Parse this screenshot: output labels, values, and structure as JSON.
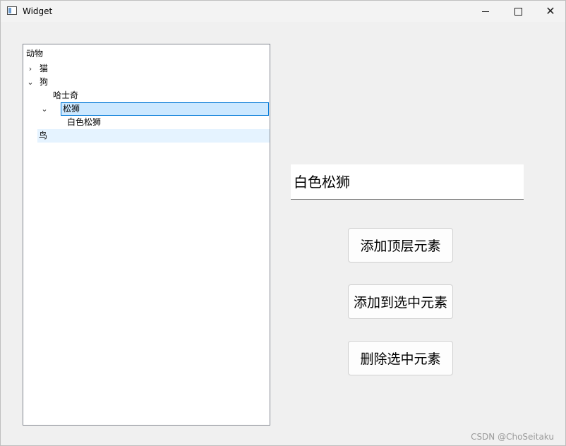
{
  "window": {
    "title": "Widget"
  },
  "tree": {
    "header": "动物",
    "items": [
      {
        "label": "猫",
        "expander": "collapsed"
      },
      {
        "label": "狗",
        "expander": "expanded"
      },
      {
        "label": "哈士奇"
      },
      {
        "label": "松狮",
        "expander": "expanded",
        "selected": true
      },
      {
        "label": "白色松狮"
      },
      {
        "label": "鸟",
        "hovered": true
      }
    ]
  },
  "display": {
    "text": "白色松狮"
  },
  "buttons": {
    "add_top": "添加顶层元素",
    "add_to_selected": "添加到选中元素",
    "delete_selected": "删除选中元素"
  },
  "watermark": "CSDN @ChoSeitaku",
  "icons": {
    "window_icon": "app-window-icon",
    "minimize": "minimize-icon",
    "maximize": "maximize-icon",
    "close": "close-icon",
    "expand": "chevron-right-icon",
    "collapse": "chevron-down-icon"
  }
}
